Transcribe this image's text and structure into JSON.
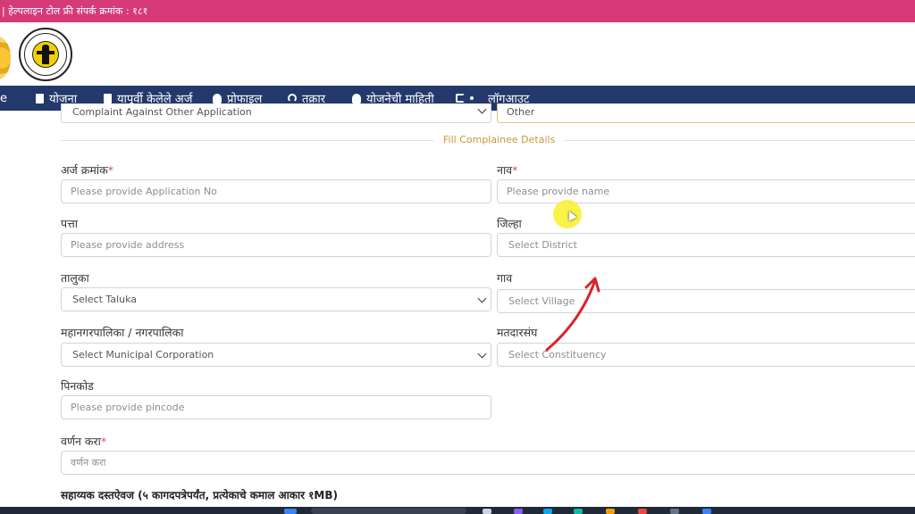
{
  "topbar": {
    "helpline_text": "| हेल्पलाइन टोल फ्री संपर्क क्रमांक : १८१"
  },
  "header": {
    "logo_top_text": "महिला व बाल विकास",
    "logo_bottom_text": "WOMEN & CHILD DEVELOPMENT"
  },
  "nav": {
    "items": [
      {
        "label": "e"
      },
      {
        "label": "योजना"
      },
      {
        "label": "यापूर्वी केलेले अर्ज"
      },
      {
        "label": "प्रोफाइल"
      },
      {
        "label": "तक्रार"
      },
      {
        "label": "योजनेची माहिती"
      },
      {
        "label": "लॉगआउट"
      }
    ]
  },
  "form": {
    "top_select_left": "Complaint Against Other Application",
    "top_select_right": "Other",
    "section_title": "Fill Complainee Details",
    "application_no": {
      "label": "अर्ज क्रमांक",
      "required": "*",
      "placeholder": "Please provide Application No"
    },
    "name": {
      "label": "नाव",
      "required": "*",
      "placeholder": "Please provide name"
    },
    "address": {
      "label": "पत्ता",
      "placeholder": "Please provide address"
    },
    "district": {
      "label": "जिल्हा",
      "value": "Select District"
    },
    "taluka": {
      "label": "तालुका",
      "value": "Select Taluka"
    },
    "village": {
      "label": "गाव",
      "value": "Select Village"
    },
    "municipal": {
      "label": "महानगरपालिका / नगरपालिका",
      "value": "Select Municipal Corporation"
    },
    "constituency": {
      "label": "मतदारसंघ",
      "value": "Select Constituency"
    },
    "pincode": {
      "label": "पिनकोड",
      "placeholder": "Please provide pincode"
    },
    "description": {
      "label": "वर्णन करा",
      "required": "*",
      "placeholder": "वर्णन करा"
    },
    "documents_heading": "सहाय्यक दस्तऐवज (५ कागदपत्रेपर्यंत, प्रत्येकाचे कमाल आकार १MB)"
  },
  "colors": {
    "topbar": "#d63a79",
    "navbar": "#23386b",
    "section_title": "#c9963a",
    "required_star": "#d9534f",
    "annotation_arrow": "#d8232a"
  }
}
